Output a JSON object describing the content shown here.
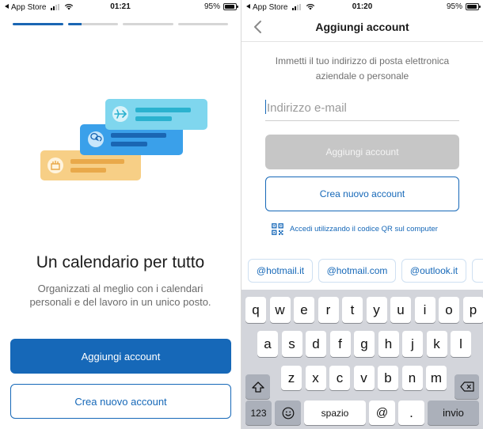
{
  "left": {
    "status": {
      "carrier": "App Store",
      "time": "01:21",
      "battery": "95%"
    },
    "progress": [
      1,
      0.28,
      0,
      0
    ],
    "headline": "Un calendario per tutto",
    "subtext": "Organizzati al meglio con i calendari personali e del lavoro in un unico posto.",
    "primary_button": "Aggiungi account",
    "secondary_button": "Crea nuovo account",
    "colors": {
      "accent": "#1668b8",
      "card_cyan": "#7fd6ee",
      "card_blue": "#3aa0ea",
      "card_yellow": "#f7cf86"
    }
  },
  "right": {
    "status": {
      "carrier": "App Store",
      "time": "01:20",
      "battery": "95%"
    },
    "title": "Aggiungi account",
    "instructions": "Immetti il tuo indirizzo di posta elettronica aziendale o personale",
    "email": {
      "value": "",
      "placeholder": "Indirizzo e-mail"
    },
    "add_button": "Aggiungi account",
    "create_button": "Crea nuovo account",
    "qr_link": "Accedi utilizzando il codice QR sul computer",
    "domains": [
      "@hotmail.it",
      "@hotmail.com",
      "@outlook.it"
    ],
    "keyboard": {
      "row1": [
        "q",
        "w",
        "e",
        "r",
        "t",
        "y",
        "u",
        "i",
        "o",
        "p"
      ],
      "row2": [
        "a",
        "s",
        "d",
        "f",
        "g",
        "h",
        "j",
        "k",
        "l"
      ],
      "row3": [
        "z",
        "x",
        "c",
        "v",
        "b",
        "n",
        "m"
      ],
      "numbers": "123",
      "space": "spazio",
      "at": "@",
      "dot": ".",
      "return": "invio"
    }
  }
}
